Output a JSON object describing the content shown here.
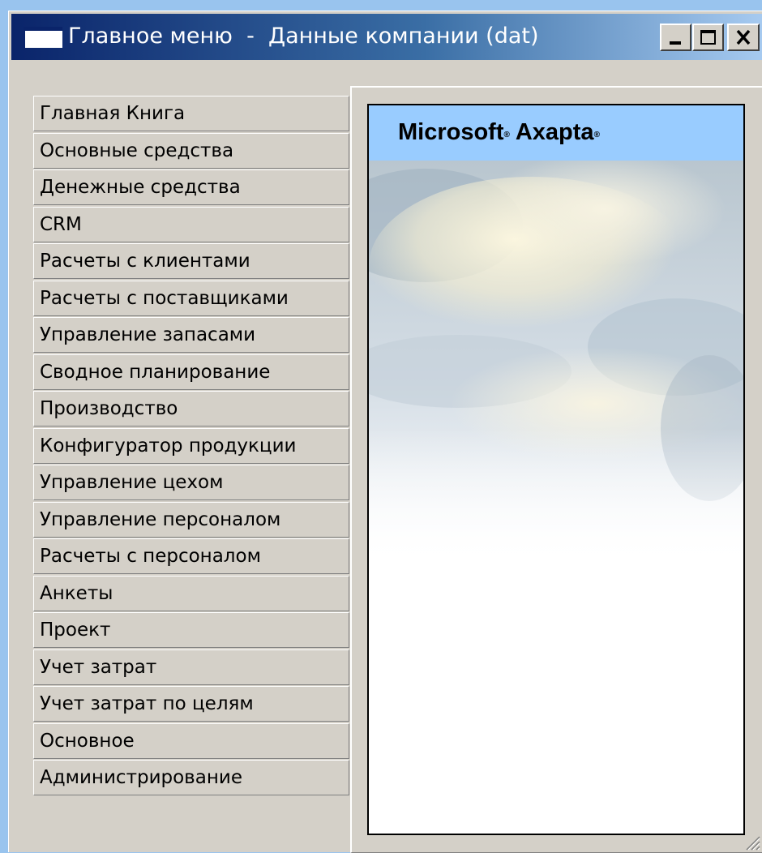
{
  "window": {
    "title": "Главное меню  -  Данные компании (dat)",
    "icon": "window-icon",
    "controls": {
      "minimize": "minimize-icon",
      "maximize": "maximize-icon",
      "close": "close-icon"
    }
  },
  "menu": {
    "items": [
      "Главная Книга",
      "Основные средства",
      "Денежные средства",
      "CRM",
      "Расчеты с клиентами",
      "Расчеты с поставщиками",
      "Управление запасами",
      "Сводное планирование",
      "Производство",
      "Конфигуратор продукции",
      "Управление цехом",
      "Управление персоналом",
      "Расчеты с персоналом",
      "Анкеты",
      "Проект",
      "Учет затрат",
      "Учет затрат по целям",
      "Основное",
      "Администрирование"
    ]
  },
  "splash": {
    "brand_word_1": "Microsoft",
    "brand_word_2": "Axapta",
    "brand_mark": "®",
    "band_color": "#99ccff"
  },
  "colors": {
    "desktop": "#99c4ee",
    "title_gradient_start": "#0a246a",
    "title_gradient_end": "#a6caf0",
    "window_face": "#d4d0c8"
  }
}
